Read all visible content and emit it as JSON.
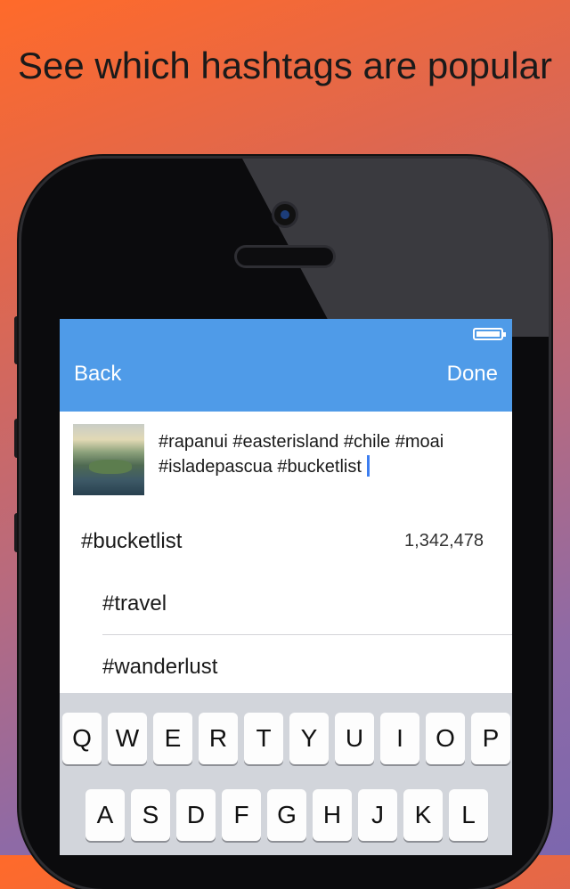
{
  "headline": "See which hashtags are popular",
  "nav": {
    "back_label": "Back",
    "done_label": "Done"
  },
  "post": {
    "caption_line1": "#rapanui #easterisland #chile #moai",
    "caption_line2": "#isladepascua #bucketlist"
  },
  "suggestions": {
    "main_tag": "#bucketlist",
    "main_count": "1,342,478",
    "related": [
      "#travel",
      "#wanderlust"
    ]
  },
  "keyboard": {
    "row1": [
      "Q",
      "W",
      "E",
      "R",
      "T",
      "Y",
      "U",
      "I",
      "O",
      "P"
    ],
    "row2": [
      "A",
      "S",
      "D",
      "F",
      "G",
      "H",
      "J",
      "K",
      "L"
    ]
  },
  "colors": {
    "nav_bar": "#4f9be8",
    "cursor": "#3d7ef0"
  }
}
